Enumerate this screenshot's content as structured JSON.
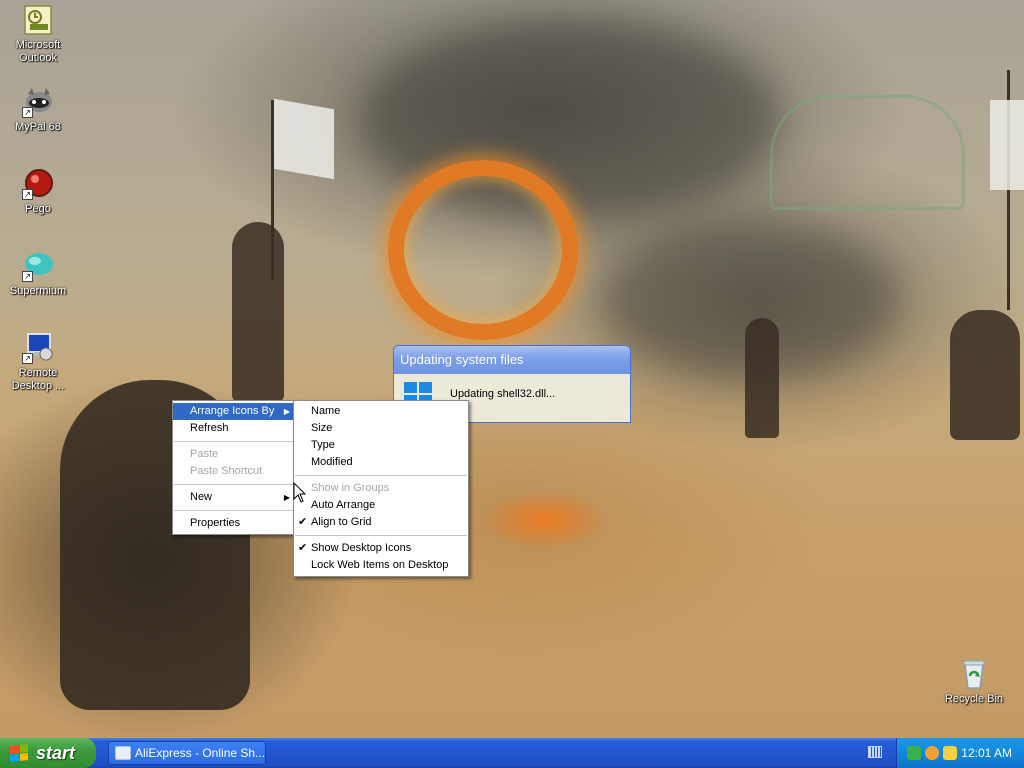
{
  "desktop_icons": [
    {
      "id": "outlook",
      "label": "Microsoft\nOutlook",
      "icon": "outlook-icon",
      "shortcut": false
    },
    {
      "id": "mypal",
      "label": "MyPal 68",
      "icon": "mypal-icon",
      "shortcut": true
    },
    {
      "id": "pego",
      "label": "Pego",
      "icon": "pego-icon",
      "shortcut": true
    },
    {
      "id": "supermium",
      "label": "Supermium",
      "icon": "supermium-icon",
      "shortcut": true
    },
    {
      "id": "rdp",
      "label": "Remote\nDesktop ...",
      "icon": "remote-desktop-icon",
      "shortcut": true
    },
    {
      "id": "recycle",
      "label": "Recycle Bin",
      "icon": "recycle-bin-icon",
      "shortcut": false
    }
  ],
  "context_menu": {
    "items": [
      {
        "label": "Arrange Icons By",
        "selected": true,
        "submenu": true
      },
      {
        "label": "Refresh"
      },
      {
        "separator": true
      },
      {
        "label": "Paste",
        "disabled": true
      },
      {
        "label": "Paste Shortcut",
        "disabled": true
      },
      {
        "separator": true
      },
      {
        "label": "New",
        "submenu": true
      },
      {
        "separator": true
      },
      {
        "label": "Properties"
      }
    ]
  },
  "arrange_submenu": {
    "items": [
      {
        "label": "Name"
      },
      {
        "label": "Size"
      },
      {
        "label": "Type"
      },
      {
        "label": "Modified"
      },
      {
        "separator": true
      },
      {
        "label": "Show in Groups",
        "disabled": true
      },
      {
        "label": "Auto Arrange"
      },
      {
        "label": "Align to Grid",
        "checked": true
      },
      {
        "separator": true
      },
      {
        "label": "Show Desktop Icons",
        "checked": true
      },
      {
        "label": "Lock Web Items on Desktop"
      }
    ]
  },
  "dialog": {
    "title": "Updating system files",
    "message": "Updating shell32.dll...",
    "icon": "windows-logo-icon"
  },
  "taskbar": {
    "start_label": "start",
    "task_button_label": "AliExpress - Online Sh...",
    "clock": "12:01 AM"
  },
  "colors": {
    "taskbar": "#245edb",
    "start": "#3c9a3c",
    "menu_highlight": "#316ac5",
    "tray": "#1288dc"
  }
}
